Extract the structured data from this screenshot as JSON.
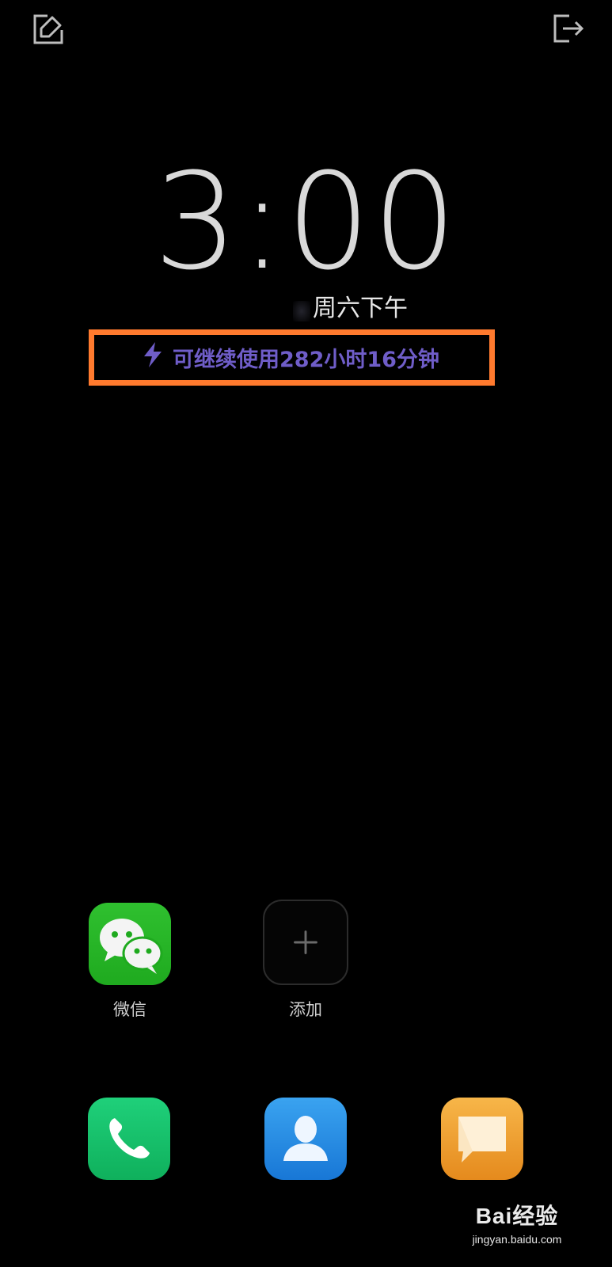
{
  "lockscreen": {
    "time": "3:00",
    "date": "周六下午",
    "battery_text": "可继续使用282小时16分钟",
    "accent_color": "#6f5dc8",
    "highlight_color": "#ff7a2e"
  },
  "top_bar": {
    "edit_icon": "edit-icon",
    "exit_icon": "exit-icon"
  },
  "apps": [
    {
      "label": "微信",
      "icon": "wechat-icon"
    },
    {
      "label": "添加",
      "icon": "plus-icon"
    }
  ],
  "dock": [
    {
      "icon": "phone-icon"
    },
    {
      "icon": "contacts-icon"
    },
    {
      "icon": "messages-icon"
    }
  ],
  "watermark": {
    "main": "Bai经验",
    "sub": "jingyan.baidu.com"
  }
}
